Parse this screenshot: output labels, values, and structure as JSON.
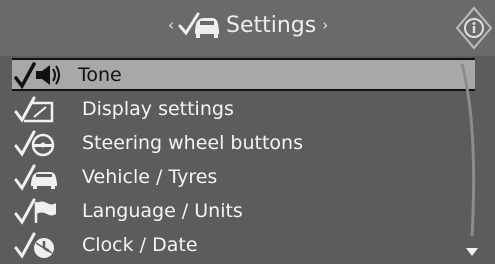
{
  "header": {
    "title": "Settings",
    "left_arrow": "‹",
    "right_arrow": "›"
  },
  "menu": {
    "items": [
      {
        "label": "Tone",
        "icon": "tone-icon",
        "selected": true
      },
      {
        "label": "Display settings",
        "icon": "display-icon",
        "selected": false
      },
      {
        "label": "Steering wheel buttons",
        "icon": "steering-wheel-icon",
        "selected": false
      },
      {
        "label": "Vehicle / Tyres",
        "icon": "vehicle-icon",
        "selected": false
      },
      {
        "label": "Language / Units",
        "icon": "flag-icon",
        "selected": false
      },
      {
        "label": "Clock / Date",
        "icon": "clock-icon",
        "selected": false
      }
    ]
  },
  "colors": {
    "header_bg": "#6a6a6a",
    "list_bg": "#5c5c5c",
    "selected_bg": "#a8a8a8",
    "text": "#f2f2f2"
  }
}
